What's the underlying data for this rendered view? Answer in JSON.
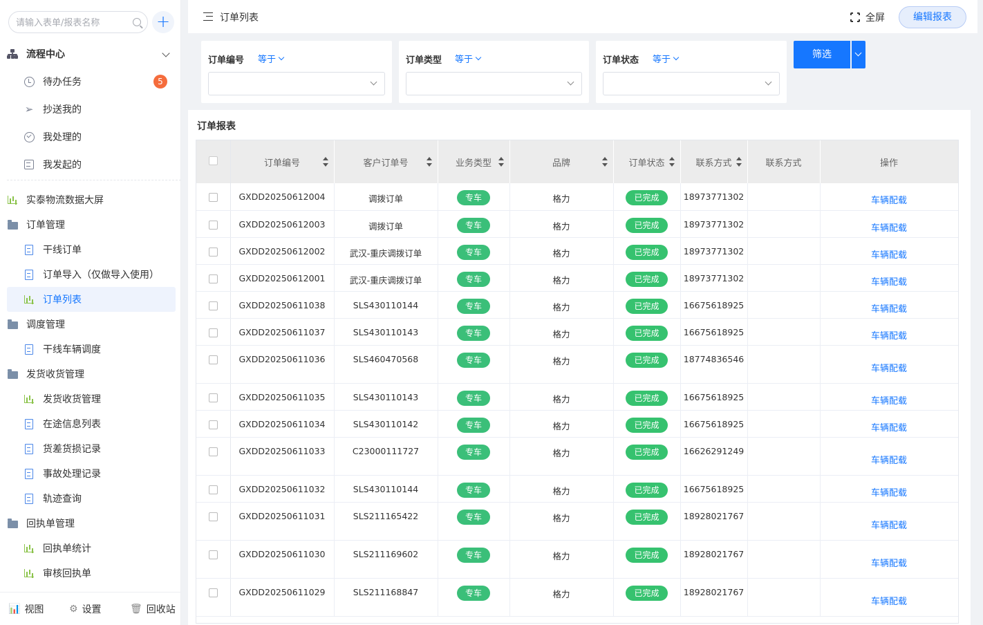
{
  "sidebar": {
    "search_placeholder": "请输入表单/报表名称",
    "flow_center": "流程中心",
    "flow_items": [
      {
        "label": "待办任务",
        "badge": "5"
      },
      {
        "label": "抄送我的"
      },
      {
        "label": "我处理的"
      },
      {
        "label": "我发起的"
      }
    ],
    "dashboard": "实泰物流数据大屏",
    "groups": [
      {
        "label": "订单管理",
        "items": [
          "干线订单",
          "订单导入（仅做导入使用）",
          "订单列表"
        ]
      },
      {
        "label": "调度管理",
        "items": [
          "干线车辆调度"
        ]
      },
      {
        "label": "发货收货管理",
        "items": [
          "发货收货管理",
          "在途信息列表",
          "货差货损记录",
          "事故处理记录",
          "轨迹查询"
        ]
      },
      {
        "label": "回执单管理",
        "items": [
          "回执单统计",
          "审核回执单"
        ]
      }
    ],
    "footer": {
      "view": "视图",
      "settings": "设置",
      "trash": "回收站"
    }
  },
  "header": {
    "title": "订单列表",
    "fullscreen": "全屏",
    "edit_report": "编辑报表"
  },
  "filters": [
    {
      "label": "订单编号",
      "op": "等于"
    },
    {
      "label": "订单类型",
      "op": "等于"
    },
    {
      "label": "订单状态",
      "op": "等于"
    }
  ],
  "filter_button": "筛选",
  "report": {
    "title": "订单报表",
    "columns": [
      "订单编号",
      "客户订单号",
      "业务类型",
      "品牌",
      "订单状态",
      "联系方式",
      "联系方式",
      "操作"
    ],
    "rows": [
      {
        "no": "GXDD20250612004",
        "cust": "调拨订单",
        "type": "专车",
        "brand": "格力",
        "status": "已完成",
        "phone": "18973771302",
        "phone2": "",
        "op": "车辆配载",
        "tall": false
      },
      {
        "no": "GXDD20250612003",
        "cust": "调拨订单",
        "type": "专车",
        "brand": "格力",
        "status": "已完成",
        "phone": "18973771302",
        "phone2": "",
        "op": "车辆配载",
        "tall": false
      },
      {
        "no": "GXDD20250612002",
        "cust": "武汉-重庆调拨订单",
        "type": "专车",
        "brand": "格力",
        "status": "已完成",
        "phone": "18973771302",
        "phone2": "",
        "op": "车辆配载",
        "tall": false
      },
      {
        "no": "GXDD20250612001",
        "cust": "武汉-重庆调拨订单",
        "type": "专车",
        "brand": "格力",
        "status": "已完成",
        "phone": "18973771302",
        "phone2": "",
        "op": "车辆配载",
        "tall": false
      },
      {
        "no": "GXDD20250611038",
        "cust": "SLS430110144",
        "type": "专车",
        "brand": "格力",
        "status": "已完成",
        "phone": "16675618925",
        "phone2": "",
        "op": "车辆配载",
        "tall": false
      },
      {
        "no": "GXDD20250611037",
        "cust": "SLS430110143",
        "type": "专车",
        "brand": "格力",
        "status": "已完成",
        "phone": "16675618925",
        "phone2": "",
        "op": "车辆配载",
        "tall": false
      },
      {
        "no": "GXDD20250611036",
        "cust": "SLS460470568",
        "type": "专车",
        "brand": "格力",
        "status": "已完成",
        "phone": "18774836546",
        "phone2": "",
        "op": "车辆配载",
        "tall": true
      },
      {
        "no": "GXDD20250611035",
        "cust": "SLS430110143",
        "type": "专车",
        "brand": "格力",
        "status": "已完成",
        "phone": "16675618925",
        "phone2": "",
        "op": "车辆配载",
        "tall": false
      },
      {
        "no": "GXDD20250611034",
        "cust": "SLS430110142",
        "type": "专车",
        "brand": "格力",
        "status": "已完成",
        "phone": "16675618925",
        "phone2": "",
        "op": "车辆配载",
        "tall": false
      },
      {
        "no": "GXDD20250611033",
        "cust": "C23000111727",
        "type": "专车",
        "brand": "格力",
        "status": "已完成",
        "phone": "16626291249",
        "phone2": "",
        "op": "车辆配载",
        "tall": true
      },
      {
        "no": "GXDD20250611032",
        "cust": "SLS430110144",
        "type": "专车",
        "brand": "格力",
        "status": "已完成",
        "phone": "16675618925",
        "phone2": "",
        "op": "车辆配载",
        "tall": false
      },
      {
        "no": "GXDD20250611031",
        "cust": "SLS211165422",
        "type": "专车",
        "brand": "格力",
        "status": "已完成",
        "phone": "18928021767",
        "phone2": "",
        "op": "车辆配载",
        "tall": true
      },
      {
        "no": "GXDD20250611030",
        "cust": "SLS211169602",
        "type": "专车",
        "brand": "格力",
        "status": "已完成",
        "phone": "18928021767",
        "phone2": "",
        "op": "车辆配载",
        "tall": true
      },
      {
        "no": "GXDD20250611029",
        "cust": "SLS211168847",
        "type": "专车",
        "brand": "格力",
        "status": "已完成",
        "phone": "18928021767",
        "phone2": "",
        "op": "车辆配载",
        "tall": true
      }
    ]
  },
  "colors": {
    "accent": "#1677ff",
    "tag_green": "#3bbf79",
    "badge": "#f56c3c"
  }
}
